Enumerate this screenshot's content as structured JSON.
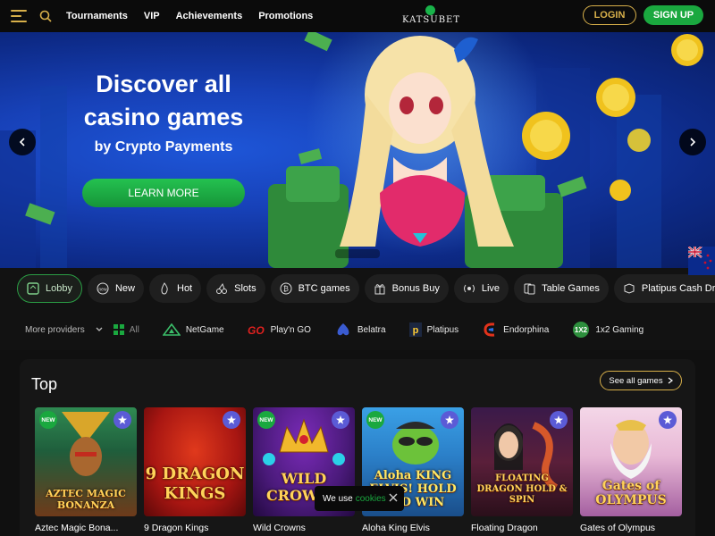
{
  "header": {
    "nav": [
      "Tournaments",
      "VIP",
      "Achievements",
      "Promotions"
    ],
    "logo_text": "KATSUBET",
    "login_label": "LOGIN",
    "signup_label": "SIGN UP"
  },
  "hero": {
    "title_line1": "Discover all",
    "title_line2": "casino games",
    "subtitle": "by Crypto Payments",
    "cta_label": "LEARN MORE"
  },
  "categories": [
    {
      "label": "Lobby",
      "icon": "lobby-icon",
      "active": true
    },
    {
      "label": "New",
      "icon": "new-icon"
    },
    {
      "label": "Hot",
      "icon": "flame-icon"
    },
    {
      "label": "Slots",
      "icon": "cherry-icon"
    },
    {
      "label": "BTC games",
      "icon": "bitcoin-icon"
    },
    {
      "label": "Bonus Buy",
      "icon": "gift-icon"
    },
    {
      "label": "Live",
      "icon": "live-icon"
    },
    {
      "label": "Table Games",
      "icon": "cards-icon"
    },
    {
      "label": "Platipus Cash Drop",
      "icon": "cash-drop-icon"
    }
  ],
  "providers": {
    "more_label": "More providers",
    "all_label": "All",
    "items": [
      "NetGame",
      "Play'n GO",
      "Belatra",
      "Platipus",
      "Endorphina",
      "1x2 Gaming"
    ]
  },
  "top": {
    "title": "Top",
    "see_all_label": "See all games",
    "games": [
      {
        "name": "Aztec Magic Bona...",
        "thumb_title": "AZTEC MAGIC BONANZA",
        "new": true
      },
      {
        "name": "9 Dragon Kings",
        "thumb_title": "9 DRAGON KINGS",
        "new": false
      },
      {
        "name": "Wild Crowns",
        "thumb_title": "WILD CROWNS",
        "new": true
      },
      {
        "name": "Aloha King Elvis",
        "thumb_title": "Aloha KING ELVIS! HOLD AND WIN",
        "new": true
      },
      {
        "name": "Floating Dragon",
        "thumb_title": "FLOATING DRAGON HOLD & SPIN",
        "new": false
      },
      {
        "name": "Gates of Olympus",
        "thumb_title": "Gates of OLYMPUS",
        "new": false
      }
    ],
    "new_badge_label": "NEW"
  },
  "cookie": {
    "text": "We use",
    "link": "cookies"
  },
  "colors": {
    "accent_gold": "#d8b04a",
    "accent_green": "#1aa83f",
    "hero_blue": "#1741b8"
  }
}
